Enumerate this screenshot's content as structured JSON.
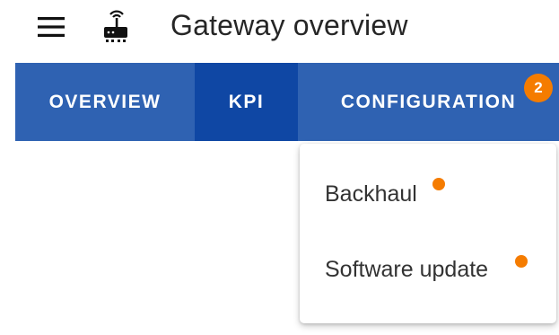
{
  "header": {
    "menu_icon": "hamburger-menu-icon",
    "device_icon": "gateway-router-icon",
    "title": "Gateway overview"
  },
  "tabs": [
    {
      "label": "OVERVIEW",
      "selected": false
    },
    {
      "label": "KPI",
      "selected": true
    },
    {
      "label": "CONFIGURATION",
      "selected": false
    }
  ],
  "config_badge": "2",
  "dropdown": {
    "items": [
      {
        "label": "Backhaul",
        "has_notification_dot": true
      },
      {
        "label": "Software update",
        "has_notification_dot": true
      }
    ]
  },
  "colors": {
    "tab_bar": "#2f62b2",
    "tab_selected": "#0f47a4",
    "badge": "#f57c00",
    "notification_dot": "#f57c00",
    "text_dark": "#262626"
  }
}
